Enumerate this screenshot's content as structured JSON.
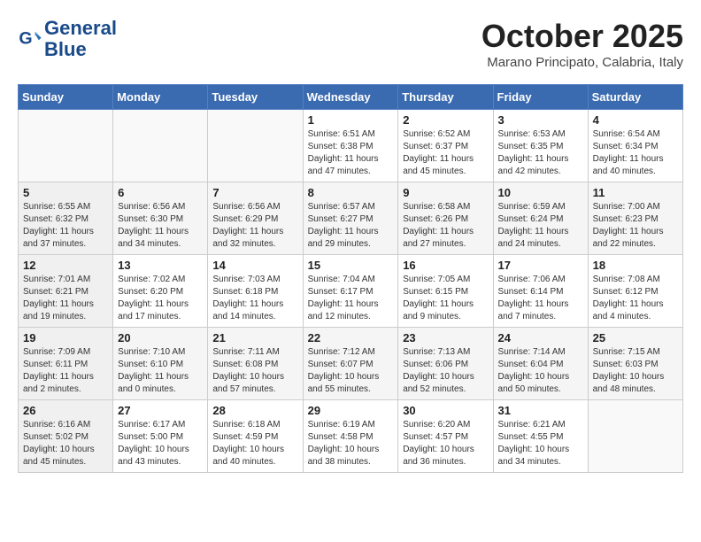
{
  "header": {
    "logo_line1": "General",
    "logo_line2": "Blue",
    "month_title": "October 2025",
    "location": "Marano Principato, Calabria, Italy"
  },
  "weekdays": [
    "Sunday",
    "Monday",
    "Tuesday",
    "Wednesday",
    "Thursday",
    "Friday",
    "Saturday"
  ],
  "weeks": [
    [
      {
        "day": "",
        "info": ""
      },
      {
        "day": "",
        "info": ""
      },
      {
        "day": "",
        "info": ""
      },
      {
        "day": "1",
        "info": "Sunrise: 6:51 AM\nSunset: 6:38 PM\nDaylight: 11 hours\nand 47 minutes."
      },
      {
        "day": "2",
        "info": "Sunrise: 6:52 AM\nSunset: 6:37 PM\nDaylight: 11 hours\nand 45 minutes."
      },
      {
        "day": "3",
        "info": "Sunrise: 6:53 AM\nSunset: 6:35 PM\nDaylight: 11 hours\nand 42 minutes."
      },
      {
        "day": "4",
        "info": "Sunrise: 6:54 AM\nSunset: 6:34 PM\nDaylight: 11 hours\nand 40 minutes."
      }
    ],
    [
      {
        "day": "5",
        "info": "Sunrise: 6:55 AM\nSunset: 6:32 PM\nDaylight: 11 hours\nand 37 minutes."
      },
      {
        "day": "6",
        "info": "Sunrise: 6:56 AM\nSunset: 6:30 PM\nDaylight: 11 hours\nand 34 minutes."
      },
      {
        "day": "7",
        "info": "Sunrise: 6:56 AM\nSunset: 6:29 PM\nDaylight: 11 hours\nand 32 minutes."
      },
      {
        "day": "8",
        "info": "Sunrise: 6:57 AM\nSunset: 6:27 PM\nDaylight: 11 hours\nand 29 minutes."
      },
      {
        "day": "9",
        "info": "Sunrise: 6:58 AM\nSunset: 6:26 PM\nDaylight: 11 hours\nand 27 minutes."
      },
      {
        "day": "10",
        "info": "Sunrise: 6:59 AM\nSunset: 6:24 PM\nDaylight: 11 hours\nand 24 minutes."
      },
      {
        "day": "11",
        "info": "Sunrise: 7:00 AM\nSunset: 6:23 PM\nDaylight: 11 hours\nand 22 minutes."
      }
    ],
    [
      {
        "day": "12",
        "info": "Sunrise: 7:01 AM\nSunset: 6:21 PM\nDaylight: 11 hours\nand 19 minutes."
      },
      {
        "day": "13",
        "info": "Sunrise: 7:02 AM\nSunset: 6:20 PM\nDaylight: 11 hours\nand 17 minutes."
      },
      {
        "day": "14",
        "info": "Sunrise: 7:03 AM\nSunset: 6:18 PM\nDaylight: 11 hours\nand 14 minutes."
      },
      {
        "day": "15",
        "info": "Sunrise: 7:04 AM\nSunset: 6:17 PM\nDaylight: 11 hours\nand 12 minutes."
      },
      {
        "day": "16",
        "info": "Sunrise: 7:05 AM\nSunset: 6:15 PM\nDaylight: 11 hours\nand 9 minutes."
      },
      {
        "day": "17",
        "info": "Sunrise: 7:06 AM\nSunset: 6:14 PM\nDaylight: 11 hours\nand 7 minutes."
      },
      {
        "day": "18",
        "info": "Sunrise: 7:08 AM\nSunset: 6:12 PM\nDaylight: 11 hours\nand 4 minutes."
      }
    ],
    [
      {
        "day": "19",
        "info": "Sunrise: 7:09 AM\nSunset: 6:11 PM\nDaylight: 11 hours\nand 2 minutes."
      },
      {
        "day": "20",
        "info": "Sunrise: 7:10 AM\nSunset: 6:10 PM\nDaylight: 11 hours\nand 0 minutes."
      },
      {
        "day": "21",
        "info": "Sunrise: 7:11 AM\nSunset: 6:08 PM\nDaylight: 10 hours\nand 57 minutes."
      },
      {
        "day": "22",
        "info": "Sunrise: 7:12 AM\nSunset: 6:07 PM\nDaylight: 10 hours\nand 55 minutes."
      },
      {
        "day": "23",
        "info": "Sunrise: 7:13 AM\nSunset: 6:06 PM\nDaylight: 10 hours\nand 52 minutes."
      },
      {
        "day": "24",
        "info": "Sunrise: 7:14 AM\nSunset: 6:04 PM\nDaylight: 10 hours\nand 50 minutes."
      },
      {
        "day": "25",
        "info": "Sunrise: 7:15 AM\nSunset: 6:03 PM\nDaylight: 10 hours\nand 48 minutes."
      }
    ],
    [
      {
        "day": "26",
        "info": "Sunrise: 6:16 AM\nSunset: 5:02 PM\nDaylight: 10 hours\nand 45 minutes."
      },
      {
        "day": "27",
        "info": "Sunrise: 6:17 AM\nSunset: 5:00 PM\nDaylight: 10 hours\nand 43 minutes."
      },
      {
        "day": "28",
        "info": "Sunrise: 6:18 AM\nSunset: 4:59 PM\nDaylight: 10 hours\nand 40 minutes."
      },
      {
        "day": "29",
        "info": "Sunrise: 6:19 AM\nSunset: 4:58 PM\nDaylight: 10 hours\nand 38 minutes."
      },
      {
        "day": "30",
        "info": "Sunrise: 6:20 AM\nSunset: 4:57 PM\nDaylight: 10 hours\nand 36 minutes."
      },
      {
        "day": "31",
        "info": "Sunrise: 6:21 AM\nSunset: 4:55 PM\nDaylight: 10 hours\nand 34 minutes."
      },
      {
        "day": "",
        "info": ""
      }
    ]
  ]
}
